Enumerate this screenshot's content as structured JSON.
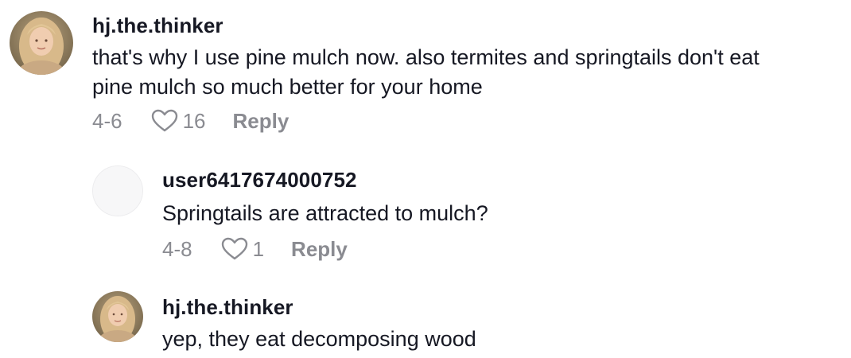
{
  "comments": [
    {
      "username": "hj.the.thinker",
      "text_line1": "that's why I use pine mulch now. also termites and springtails don't eat",
      "text_line2": "pine mulch so much better for your home",
      "date": "4-6",
      "likes": "16",
      "reply_label": "Reply",
      "avatar": "profile-photo"
    }
  ],
  "replies": [
    {
      "username": "user6417674000752",
      "text": "Springtails are attracted to mulch?",
      "date": "4-8",
      "likes": "1",
      "reply_label": "Reply",
      "avatar": "default-avatar"
    },
    {
      "username": "hj.the.thinker",
      "text": "yep, they eat decomposing wood",
      "avatar": "profile-photo"
    }
  ],
  "icons": {
    "like": "heart-outline-icon"
  },
  "colors": {
    "text": "#161823",
    "meta": "#8a8b91"
  }
}
